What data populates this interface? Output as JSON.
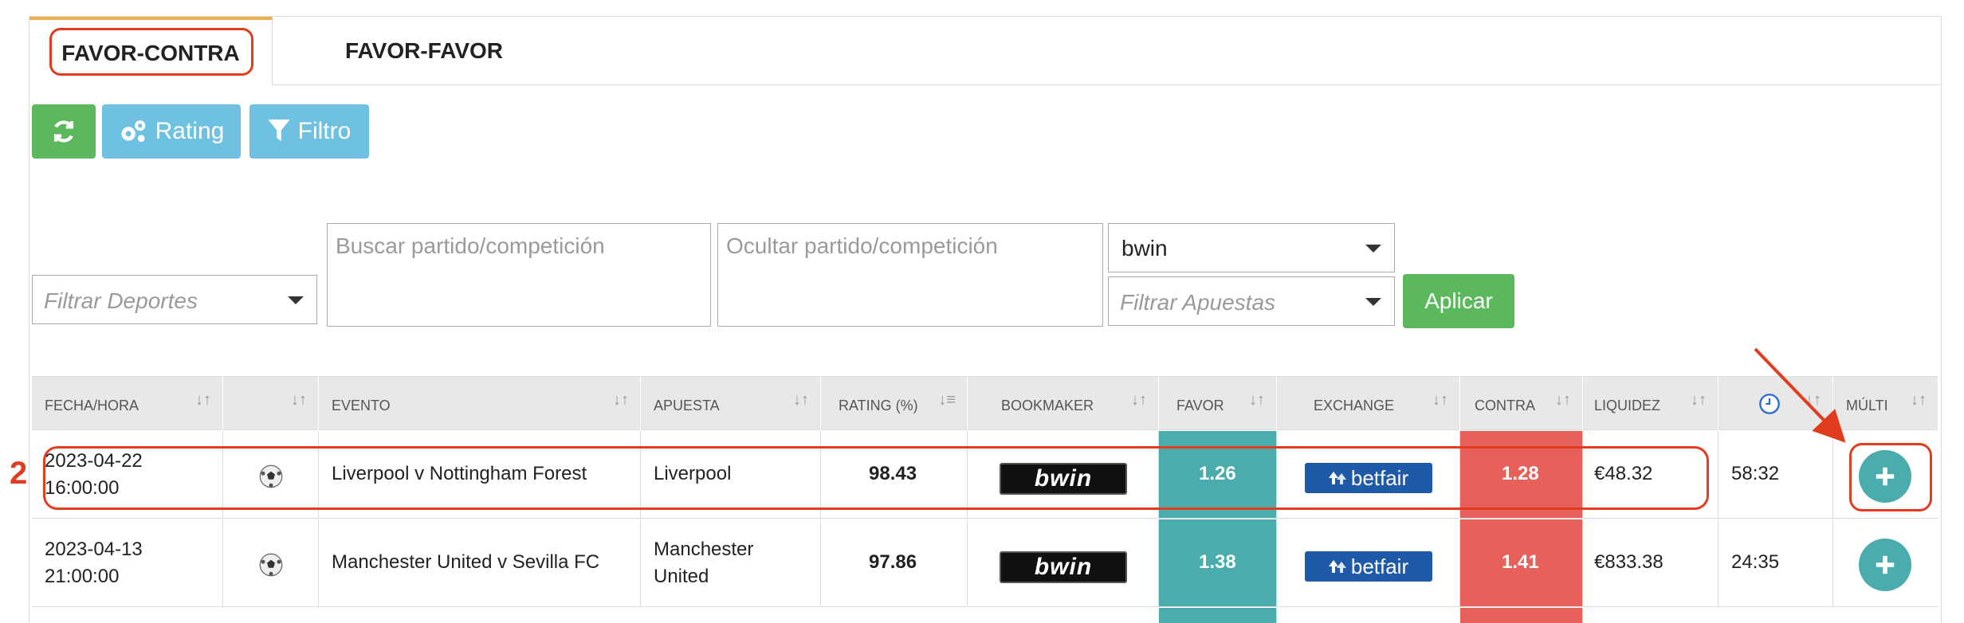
{
  "tabs": [
    {
      "label": "FAVOR-CONTRA"
    },
    {
      "label": "FAVOR-FAVOR"
    }
  ],
  "toolbar": {
    "rating_label": "Rating",
    "filtro_label": "Filtro"
  },
  "filters": {
    "deportes_placeholder": "Filtrar Deportes",
    "buscar_placeholder": "Buscar partido/competición",
    "ocultar_placeholder": "Ocultar partido/competición",
    "bookmaker_value": "bwin",
    "apuestas_placeholder": "Filtrar Apuestas",
    "apply_label": "Aplicar"
  },
  "table": {
    "headers": [
      "FECHA/HORA",
      "",
      "EVENTO",
      "APUESTA",
      "RATING (%)",
      "BOOKMAKER",
      "FAVOR",
      "EXCHANGE",
      "CONTRA",
      "LIQUIDEZ",
      "",
      "MÚLTI"
    ],
    "rows": [
      {
        "date": "2023-04-22",
        "time": "16:00:00",
        "event": "Liverpool v Nottingham Forest",
        "bet_line1": "Liverpool",
        "bet_line2": "",
        "rating": "98.43",
        "bookmaker": "bwin",
        "favor": "1.26",
        "exchange": "betfair",
        "contra": "1.28",
        "liquidity": "€48.32",
        "countdown": "58:32"
      },
      {
        "date": "2023-04-13",
        "time": "21:00:00",
        "event": "Manchester United v Sevilla FC",
        "bet_line1": "Manchester",
        "bet_line2": "United",
        "rating": "97.86",
        "bookmaker": "bwin",
        "favor": "1.38",
        "exchange": "betfair",
        "contra": "1.41",
        "liquidity": "€833.38",
        "countdown": "24:35"
      }
    ]
  },
  "annotations": {
    "step_number": "2"
  },
  "colors": {
    "green": "#5cb85c",
    "light_blue": "#6ec1e0",
    "favor": "#4aacac",
    "contra": "#e8605a",
    "annotation_red": "#e23c1e",
    "tab_accent": "#f0ad4e"
  }
}
